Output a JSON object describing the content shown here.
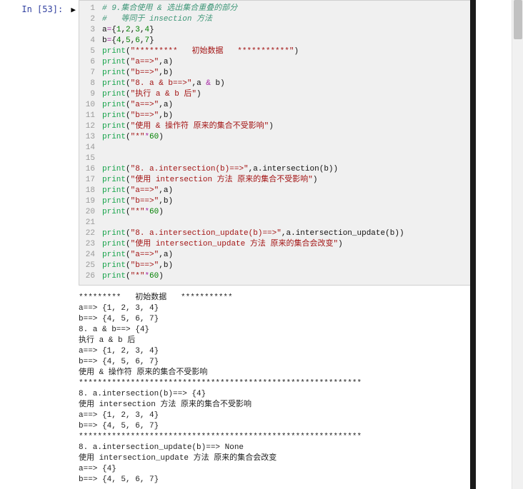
{
  "prompt": {
    "label": "In [53]:"
  },
  "code": {
    "lines": [
      [
        [
          "comment",
          "# 9.集合使用 & 选出集合重叠的部分"
        ]
      ],
      [
        [
          "comment",
          "#   等同于 insection 方法"
        ]
      ],
      [
        [
          "name",
          "a"
        ],
        [
          "op",
          "="
        ],
        [
          "punc",
          "{"
        ],
        [
          "num",
          "1"
        ],
        [
          "punc",
          ","
        ],
        [
          "num",
          "2"
        ],
        [
          "punc",
          ","
        ],
        [
          "num",
          "3"
        ],
        [
          "punc",
          ","
        ],
        [
          "num",
          "4"
        ],
        [
          "punc",
          "}"
        ]
      ],
      [
        [
          "name",
          "b"
        ],
        [
          "op",
          "="
        ],
        [
          "punc",
          "{"
        ],
        [
          "num",
          "4"
        ],
        [
          "punc",
          ","
        ],
        [
          "num",
          "5"
        ],
        [
          "punc",
          ","
        ],
        [
          "num",
          "6"
        ],
        [
          "punc",
          ","
        ],
        [
          "num",
          "7"
        ],
        [
          "punc",
          "}"
        ]
      ],
      [
        [
          "func",
          "print"
        ],
        [
          "punc",
          "("
        ],
        [
          "str",
          "\"*********   初始数据   ***********\""
        ],
        [
          "punc",
          ")"
        ]
      ],
      [
        [
          "func",
          "print"
        ],
        [
          "punc",
          "("
        ],
        [
          "str",
          "\"a==>\""
        ],
        [
          "punc",
          ","
        ],
        [
          "name",
          "a"
        ],
        [
          "punc",
          ")"
        ]
      ],
      [
        [
          "func",
          "print"
        ],
        [
          "punc",
          "("
        ],
        [
          "str",
          "\"b==>\""
        ],
        [
          "punc",
          ","
        ],
        [
          "name",
          "b"
        ],
        [
          "punc",
          ")"
        ]
      ],
      [
        [
          "func",
          "print"
        ],
        [
          "punc",
          "("
        ],
        [
          "str",
          "\"8. a & b==>\""
        ],
        [
          "punc",
          ","
        ],
        [
          "name",
          "a "
        ],
        [
          "op",
          "&"
        ],
        [
          "name",
          " b"
        ],
        [
          "punc",
          ")"
        ]
      ],
      [
        [
          "func",
          "print"
        ],
        [
          "punc",
          "("
        ],
        [
          "str",
          "\"执行 a & b 后\""
        ],
        [
          "punc",
          ")"
        ]
      ],
      [
        [
          "func",
          "print"
        ],
        [
          "punc",
          "("
        ],
        [
          "str",
          "\"a==>\""
        ],
        [
          "punc",
          ","
        ],
        [
          "name",
          "a"
        ],
        [
          "punc",
          ")"
        ]
      ],
      [
        [
          "func",
          "print"
        ],
        [
          "punc",
          "("
        ],
        [
          "str",
          "\"b==>\""
        ],
        [
          "punc",
          ","
        ],
        [
          "name",
          "b"
        ],
        [
          "punc",
          ")"
        ]
      ],
      [
        [
          "func",
          "print"
        ],
        [
          "punc",
          "("
        ],
        [
          "str",
          "\"使用 & 操作符 原来的集合不受影响\""
        ],
        [
          "punc",
          ")"
        ]
      ],
      [
        [
          "func",
          "print"
        ],
        [
          "punc",
          "("
        ],
        [
          "str",
          "\"*\""
        ],
        [
          "op",
          "*"
        ],
        [
          "num",
          "60"
        ],
        [
          "punc",
          ")"
        ]
      ],
      [],
      [],
      [
        [
          "func",
          "print"
        ],
        [
          "punc",
          "("
        ],
        [
          "str",
          "\"8. a.intersection(b)==>\""
        ],
        [
          "punc",
          ","
        ],
        [
          "name",
          "a"
        ],
        [
          "punc",
          "."
        ],
        [
          "name",
          "intersection"
        ],
        [
          "punc",
          "("
        ],
        [
          "name",
          "b"
        ],
        [
          "punc",
          ")"
        ],
        [
          "punc",
          ")"
        ]
      ],
      [
        [
          "func",
          "print"
        ],
        [
          "punc",
          "("
        ],
        [
          "str",
          "\"使用 intersection 方法 原来的集合不受影响\""
        ],
        [
          "punc",
          ")"
        ]
      ],
      [
        [
          "func",
          "print"
        ],
        [
          "punc",
          "("
        ],
        [
          "str",
          "\"a==>\""
        ],
        [
          "punc",
          ","
        ],
        [
          "name",
          "a"
        ],
        [
          "punc",
          ")"
        ]
      ],
      [
        [
          "func",
          "print"
        ],
        [
          "punc",
          "("
        ],
        [
          "str",
          "\"b==>\""
        ],
        [
          "punc",
          ","
        ],
        [
          "name",
          "b"
        ],
        [
          "punc",
          ")"
        ]
      ],
      [
        [
          "func",
          "print"
        ],
        [
          "punc",
          "("
        ],
        [
          "str",
          "\"*\""
        ],
        [
          "op",
          "*"
        ],
        [
          "num",
          "60"
        ],
        [
          "punc",
          ")"
        ]
      ],
      [],
      [
        [
          "func",
          "print"
        ],
        [
          "punc",
          "("
        ],
        [
          "str",
          "\"8. a.intersection_update(b)==>\""
        ],
        [
          "punc",
          ","
        ],
        [
          "name",
          "a"
        ],
        [
          "punc",
          "."
        ],
        [
          "name",
          "intersection_update"
        ],
        [
          "punc",
          "("
        ],
        [
          "name",
          "b"
        ],
        [
          "punc",
          ")"
        ],
        [
          "punc",
          ")"
        ]
      ],
      [
        [
          "func",
          "print"
        ],
        [
          "punc",
          "("
        ],
        [
          "str",
          "\"使用 intersection_update 方法 原来的集合会改变\""
        ],
        [
          "punc",
          ")"
        ]
      ],
      [
        [
          "func",
          "print"
        ],
        [
          "punc",
          "("
        ],
        [
          "str",
          "\"a==>\""
        ],
        [
          "punc",
          ","
        ],
        [
          "name",
          "a"
        ],
        [
          "punc",
          ")"
        ]
      ],
      [
        [
          "func",
          "print"
        ],
        [
          "punc",
          "("
        ],
        [
          "str",
          "\"b==>\""
        ],
        [
          "punc",
          ","
        ],
        [
          "name",
          "b"
        ],
        [
          "punc",
          ")"
        ]
      ],
      [
        [
          "func",
          "print"
        ],
        [
          "punc",
          "("
        ],
        [
          "str",
          "\"*\""
        ],
        [
          "op",
          "*"
        ],
        [
          "num",
          "60"
        ],
        [
          "punc",
          ")"
        ]
      ]
    ]
  },
  "output": {
    "lines": [
      "*********   初始数据   ***********",
      "a==> {1, 2, 3, 4}",
      "b==> {4, 5, 6, 7}",
      "8. a & b==> {4}",
      "执行 a & b 后",
      "a==> {1, 2, 3, 4}",
      "b==> {4, 5, 6, 7}",
      "使用 & 操作符 原来的集合不受影响",
      "************************************************************",
      "8. a.intersection(b)==> {4}",
      "使用 intersection 方法 原来的集合不受影响",
      "a==> {1, 2, 3, 4}",
      "b==> {4, 5, 6, 7}",
      "************************************************************",
      "8. a.intersection_update(b)==> None",
      "使用 intersection_update 方法 原来的集合会改变",
      "a==> {4}",
      "b==> {4, 5, 6, 7}"
    ]
  }
}
